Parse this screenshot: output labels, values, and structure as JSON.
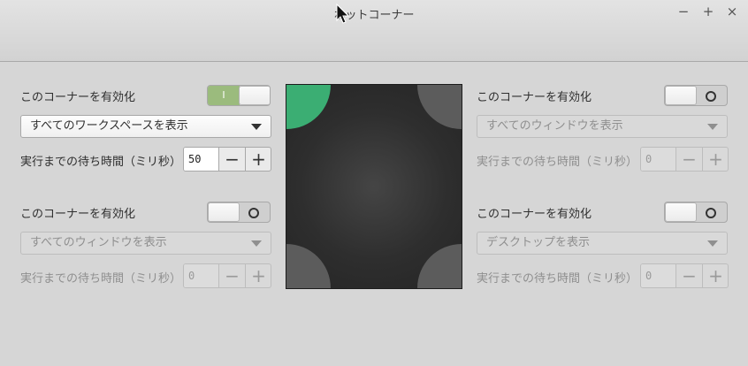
{
  "window": {
    "title": "ホットコーナー",
    "minimize_label": "−",
    "maximize_label": "+",
    "close_label": "×"
  },
  "colors": {
    "active_corner": "#3bae73",
    "inactive_corner": "#5c5c5c",
    "toggle_on": "#9bbb7d"
  },
  "corners": {
    "top_left": {
      "enable_label": "このコーナーを有効化",
      "enabled": true,
      "toggle_on_label": "I",
      "action": "すべてのワークスペースを表示",
      "delay_label": "実行までの待ち時間（ミリ秒）",
      "delay_value": "50"
    },
    "top_right": {
      "enable_label": "このコーナーを有効化",
      "enabled": false,
      "action": "すべてのウィンドウを表示",
      "delay_label": "実行までの待ち時間（ミリ秒）",
      "delay_value": "0"
    },
    "bottom_left": {
      "enable_label": "このコーナーを有効化",
      "enabled": false,
      "action": "すべてのウィンドウを表示",
      "delay_label": "実行までの待ち時間（ミリ秒）",
      "delay_value": "0"
    },
    "bottom_right": {
      "enable_label": "このコーナーを有効化",
      "enabled": false,
      "action": "デスクトップを表示",
      "delay_label": "実行までの待ち時間（ミリ秒）",
      "delay_value": "0"
    }
  },
  "spin_labels": {
    "minus": "−",
    "plus": "+"
  }
}
